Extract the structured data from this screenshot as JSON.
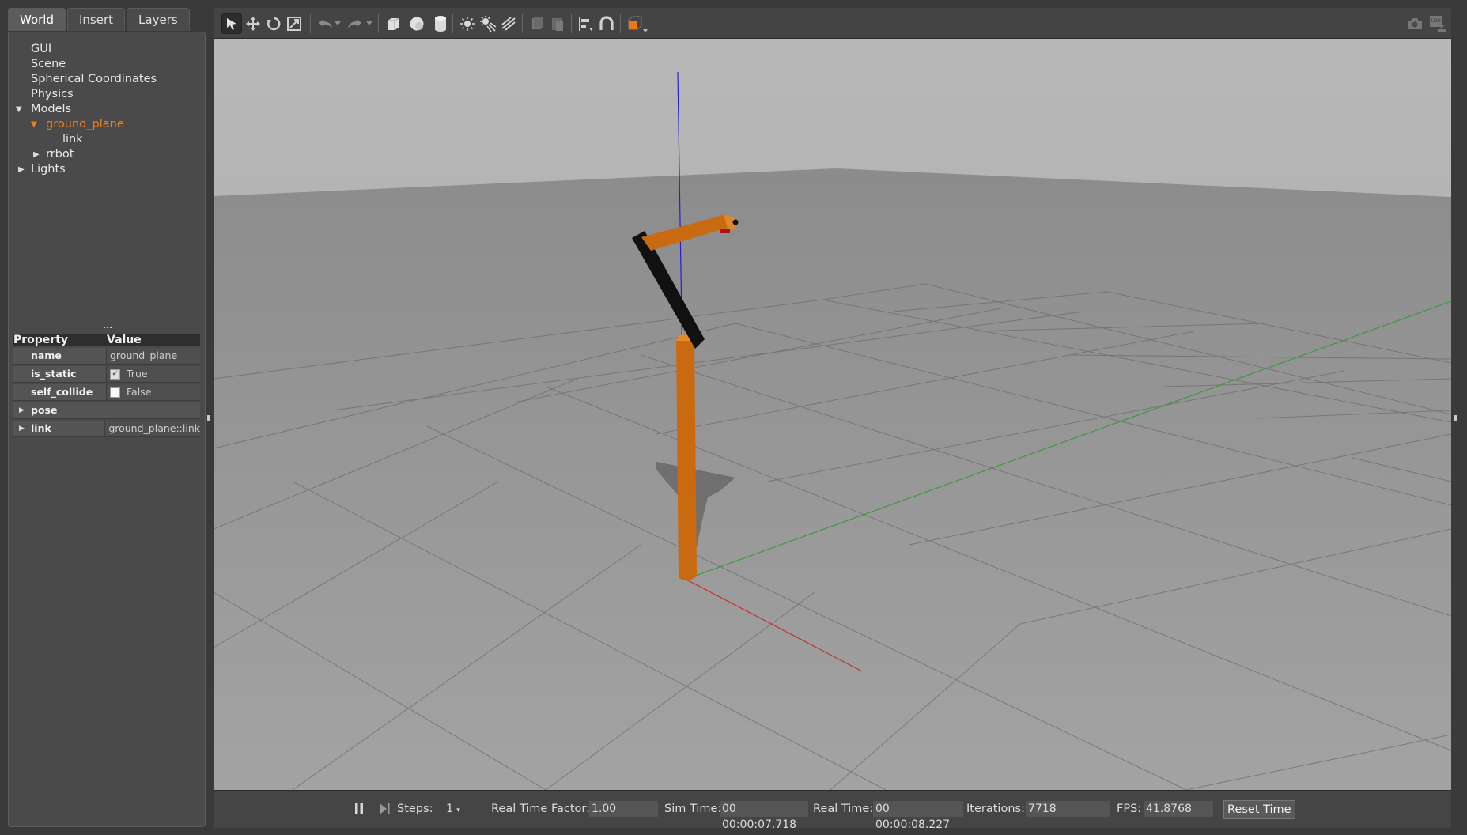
{
  "tabs": [
    "World",
    "Insert",
    "Layers"
  ],
  "tree": {
    "gui": "GUI",
    "scene": "Scene",
    "spherical": "Spherical Coordinates",
    "physics": "Physics",
    "models": "Models",
    "ground_plane": "ground_plane",
    "link": "link",
    "rrbot": "rrbot",
    "lights": "Lights"
  },
  "properties": {
    "header_property": "Property",
    "header_value": "Value",
    "rows": [
      {
        "name": "name",
        "value": "ground_plane"
      },
      {
        "name": "is_static",
        "value": "True",
        "checked": true
      },
      {
        "name": "self_collide",
        "value": "False",
        "checked": false
      },
      {
        "name": "pose",
        "value": ""
      },
      {
        "name": "link",
        "value": "ground_plane::link"
      }
    ]
  },
  "toolbar": {
    "icons": [
      "select-mode-icon",
      "translate-mode-icon",
      "rotate-mode-icon",
      "scale-mode-icon",
      "undo-icon",
      "redo-icon",
      "box-icon",
      "sphere-icon",
      "cylinder-icon",
      "point-light-icon",
      "spot-light-icon",
      "directional-light-icon",
      "copy-icon",
      "paste-icon",
      "align-icon",
      "snap-icon",
      "view-angle-icon",
      "screenshot-icon",
      "log-icon"
    ]
  },
  "status": {
    "steps_label": "Steps:",
    "steps_value": "1",
    "rtf_label": "Real Time Factor:",
    "rtf_value": "1.00",
    "sim_label": "Sim Time:",
    "sim_value": "00 00:00:07.718",
    "real_label": "Real Time:",
    "real_value": "00 00:00:08.227",
    "iter_label": "Iterations:",
    "iter_value": "7718",
    "fps_label": "FPS:",
    "fps_value": "41.8768",
    "reset_label": "Reset Time"
  },
  "colors": {
    "accent_orange": "#f0801a",
    "robot_orange": "#d9700e",
    "sky": "#b4b4b4",
    "ground": "#959595"
  }
}
